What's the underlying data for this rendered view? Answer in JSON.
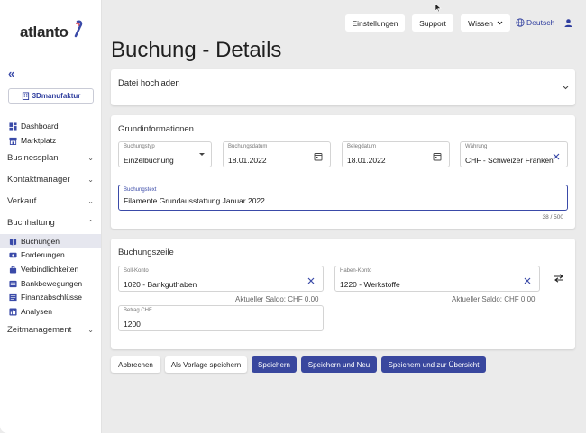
{
  "sidebar": {
    "logo": "atlanto",
    "company": "3Dmanufaktur",
    "items": [
      {
        "label": "Dashboard"
      },
      {
        "label": "Marktplatz"
      }
    ],
    "sections": [
      {
        "label": "Businessplan",
        "chevron": "⌄"
      },
      {
        "label": "Kontaktmanager",
        "chevron": "⌄"
      },
      {
        "label": "Verkauf",
        "chevron": "⌄"
      },
      {
        "label": "Buchhaltung",
        "chevron": "⌃"
      },
      {
        "label": "Zeitmanagement",
        "chevron": "⌄"
      }
    ],
    "buchhaltung_items": [
      {
        "label": "Buchungen"
      },
      {
        "label": "Forderungen"
      },
      {
        "label": "Verbindlichkeiten"
      },
      {
        "label": "Bankbewegungen"
      },
      {
        "label": "Finanzabschlüsse"
      },
      {
        "label": "Analysen"
      }
    ]
  },
  "topbar": {
    "settings": "Einstellungen",
    "support": "Support",
    "wissen": "Wissen",
    "language": "Deutsch"
  },
  "page": {
    "title": "Buchung - Details"
  },
  "upload": {
    "title": "Datei hochladen"
  },
  "grund": {
    "title": "Grundinformationen",
    "buchungstyp_label": "Buchungstyp",
    "buchungstyp_value": "Einzelbuchung",
    "buchungsdatum_label": "Buchungsdatum",
    "buchungsdatum_value": "18.01.2022",
    "belegdatum_label": "Belegdatum",
    "belegdatum_value": "18.01.2022",
    "waehrung_label": "Währung",
    "waehrung_value": "CHF - Schweizer Franken",
    "buchungstext_label": "Buchungstext",
    "buchungstext_value": "Filamente Grundausstattung Januar 2022",
    "counter": "38 / 500"
  },
  "zeile": {
    "title": "Buchungszeile",
    "soll_label": "Soll-Konto",
    "soll_value": "1020 - Bankguthaben",
    "soll_saldo": "Aktueller Saldo: CHF 0.00",
    "haben_label": "Haben-Konto",
    "haben_value": "1220 - Werkstoffe",
    "haben_saldo": "Aktueller Saldo: CHF 0.00",
    "betrag_label": "Betrag CHF",
    "betrag_value": "1200"
  },
  "actions": {
    "cancel": "Abbrechen",
    "template": "Als Vorlage speichern",
    "save": "Speichern",
    "save_new": "Speichern und Neu",
    "save_overview": "Speichern und zur Übersicht"
  },
  "colors": {
    "accent": "#39479e",
    "background": "#ebebeb"
  }
}
